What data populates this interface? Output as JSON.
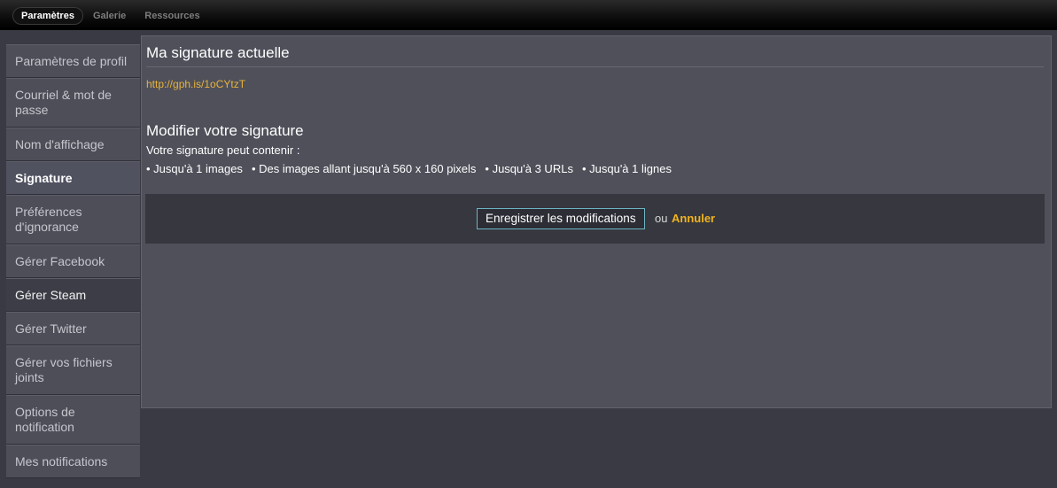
{
  "topnav": {
    "items": [
      {
        "label": "Paramètres",
        "active": true
      },
      {
        "label": "Galerie",
        "active": false
      },
      {
        "label": "Ressources",
        "active": false
      }
    ]
  },
  "sidebar": {
    "items": [
      {
        "label": "Paramètres de profil",
        "state": "normal"
      },
      {
        "label": "Courriel & mot de passe",
        "state": "normal"
      },
      {
        "label": "Nom d'affichage",
        "state": "normal"
      },
      {
        "label": "Signature",
        "state": "active"
      },
      {
        "label": "Préférences d'ignorance",
        "state": "normal"
      },
      {
        "label": "Gérer Facebook",
        "state": "normal"
      },
      {
        "label": "Gérer Steam",
        "state": "hover"
      },
      {
        "label": "Gérer Twitter",
        "state": "normal"
      },
      {
        "label": "Gérer vos fichiers joints",
        "state": "normal"
      },
      {
        "label": "Options de notification",
        "state": "normal"
      },
      {
        "label": "Mes notifications",
        "state": "normal"
      }
    ]
  },
  "main": {
    "current_heading": "Ma signature actuelle",
    "current_signature": "http://gph.is/1oCYtzT",
    "modify_heading": "Modifier votre signature",
    "rules_intro": "Votre signature peut contenir :",
    "rules": [
      "Jusqu'à 1 images",
      "Des images allant jusqu'à 560 x 160 pixels",
      "Jusqu'à 3 URLs",
      "Jusqu'à 1 lignes"
    ],
    "save_label": "Enregistrer les modifications",
    "or_label": "ou",
    "cancel_label": "Annuler"
  },
  "colors": {
    "link": "#e8b33b",
    "cancel": "#f1b41f",
    "button_border": "#6db5c4"
  }
}
